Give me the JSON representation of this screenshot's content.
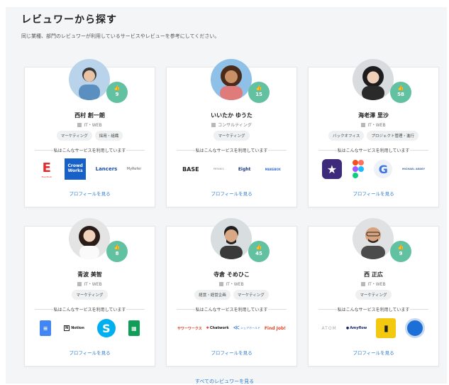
{
  "section": {
    "title": "レビュワーから探す",
    "lead": "同じ業種、部門のレビュワーが利用しているサービスやレビューを参考にしてください。",
    "uses_label": "私はこんなサービスを利用しています",
    "profile_link": "プロフィールを見る",
    "all_link": "すべてのレビュワーを見る"
  },
  "reviewers": [
    {
      "name": "西村 創一朗",
      "industry": "IT・WEB",
      "likes": "9",
      "tags": [
        "マーケティング",
        "採用・組織"
      ],
      "avatar_color": "#b9d4ea",
      "services": [
        "Eventhub",
        "Crowd Works",
        "Lancers",
        "MyRefer"
      ]
    },
    {
      "name": "いいたか ゆうた",
      "industry": "コンサルティング",
      "likes": "15",
      "tags": [
        "マーケティング"
      ],
      "avatar_color": "#8fc0e8",
      "services": [
        "BASE",
        "PRTIMES",
        "Eight",
        "MAKEBOX"
      ]
    },
    {
      "name": "海老澤 里沙",
      "industry": "IT・WEB",
      "likes": "58",
      "tags": [
        "バックオフィス",
        "プロジェクト管理・進行"
      ],
      "avatar_color": "#d9dcdf",
      "services": [
        "iMovie",
        "Figma",
        "Gamma",
        "MICHAEL ARDEY"
      ]
    },
    {
      "name": "青波 美智",
      "industry": "IT・WEB",
      "likes": "8",
      "tags": [
        "マーケティング"
      ],
      "avatar_color": "#e4e4e4",
      "services": [
        "Google Docs",
        "Notion",
        "Skype",
        "Google Sheets"
      ]
    },
    {
      "name": "寺倉 そめひこ",
      "industry": "IT・WEB",
      "likes": "45",
      "tags": [
        "経営・経営企画",
        "マーケティング"
      ],
      "avatar_color": "#d8dde0",
      "services": [
        "サワーワークス",
        "Chatwork",
        "シェアホールド",
        "Find Job!"
      ]
    },
    {
      "name": "西 正広",
      "industry": "IT・WEB",
      "likes": "9",
      "tags": [
        "マーケティング"
      ],
      "avatar_color": "#dfe1e3",
      "services": [
        "ATOM",
        "Amyflow",
        "Power BI",
        "Thunderbird"
      ]
    }
  ]
}
